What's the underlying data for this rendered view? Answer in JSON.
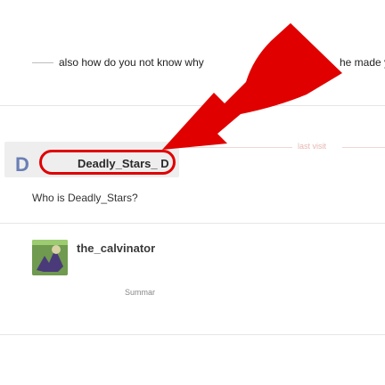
{
  "top_post": {
    "text_left": "also how do you not know why",
    "text_right": "he made y"
  },
  "timeline": {
    "last_visit_label": "last visit"
  },
  "quote": {
    "avatar_letter": "D",
    "topic_title": "Deadly_Stars_ D"
  },
  "post": {
    "question": "Who is Deadly_Stars?"
  },
  "reply": {
    "username": "the_calvinator",
    "summary_stub": "Summar"
  },
  "colors": {
    "annotation_red": "#e00000",
    "background": "#ffffff",
    "divider": "#e6e6e6"
  }
}
